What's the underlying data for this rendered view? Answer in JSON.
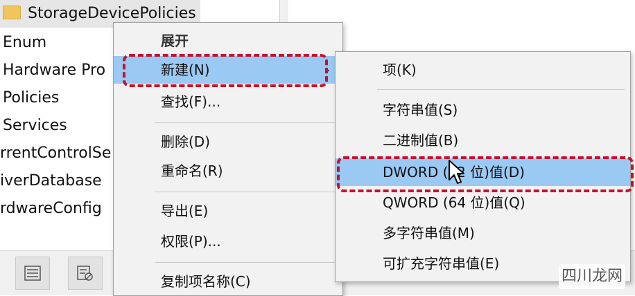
{
  "tree": {
    "items": [
      "StorageDevicePolicies",
      "Enum",
      "Hardware Pro",
      "Policies",
      "Services",
      "rrentControlSe",
      "iverDatabase",
      "rdwareConfig"
    ]
  },
  "menu1": {
    "header": "展开",
    "new": "新建(N)",
    "find": "查找(F)...",
    "delete": "删除(D)",
    "rename": "重命名(R)",
    "export": "导出(E)",
    "permissions": "权限(P)...",
    "copy_name": "复制项名称(C)",
    "arrow": "›"
  },
  "menu2": {
    "key": "项(K)",
    "string": "字符串值(S)",
    "binary": "二进制值(B)",
    "dword": "DWORD (32 位)值(D)",
    "qword": "QWORD (64 位)值(Q)",
    "multistring": "多字符串值(M)",
    "expandstring": "可扩充字符串值(E)"
  },
  "watermark": "四川龙网",
  "colors": {
    "highlight": "#9ac9f3",
    "dash": "#c8102e",
    "menu_bg": "#f2f2f2"
  }
}
